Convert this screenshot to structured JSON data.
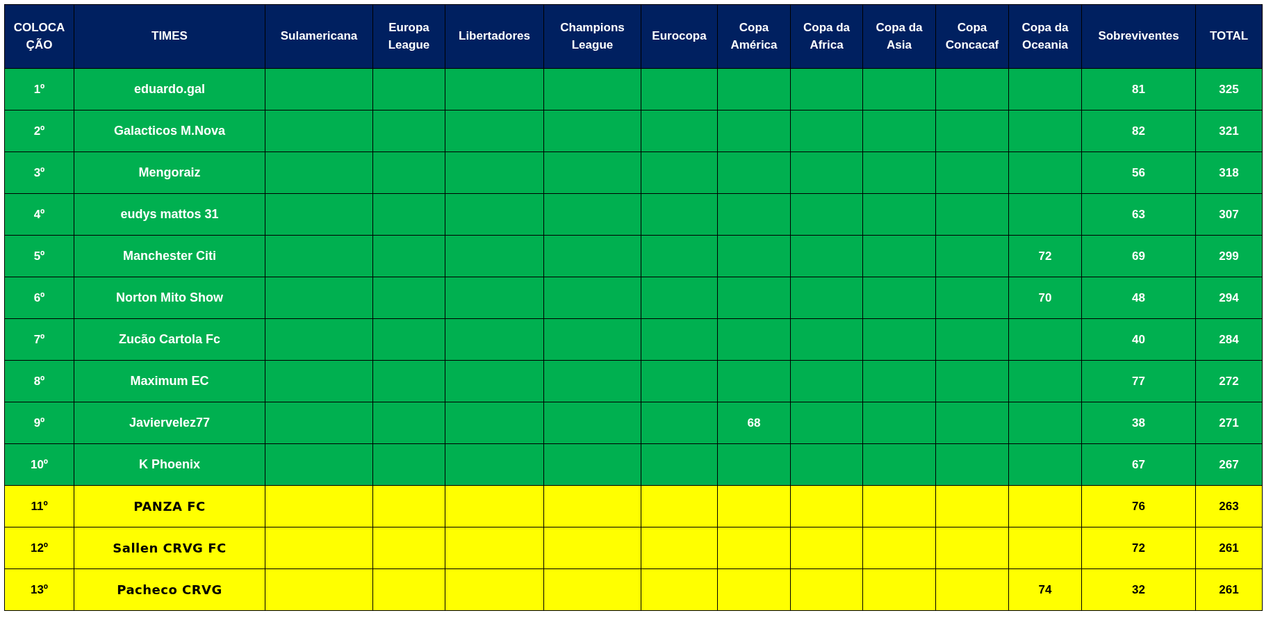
{
  "table": {
    "columns": [
      {
        "label": "COLOCA ÇÃO"
      },
      {
        "label": "TIMES"
      },
      {
        "label": "Sulamericana"
      },
      {
        "label": "Europa League"
      },
      {
        "label": "Libertadores"
      },
      {
        "label": "Champions League"
      },
      {
        "label": "Eurocopa"
      },
      {
        "label": "Copa América"
      },
      {
        "label": "Copa da Africa"
      },
      {
        "label": "Copa da Asia"
      },
      {
        "label": "Copa Concacaf"
      },
      {
        "label": "Copa da Oceania"
      },
      {
        "label": "Sobreviventes"
      },
      {
        "label": "TOTAL"
      }
    ],
    "rows": [
      {
        "color": "#00b050",
        "kind": "plain",
        "cells": [
          "1º",
          "eduardo.gal",
          null,
          null,
          null,
          null,
          null,
          null,
          null,
          null,
          null,
          null,
          "81",
          "325"
        ]
      },
      {
        "color": "#00b050",
        "kind": "plain",
        "cells": [
          "2º",
          "Galacticos M.Nova",
          null,
          null,
          null,
          null,
          null,
          null,
          null,
          null,
          null,
          null,
          "82",
          "321"
        ]
      },
      {
        "color": "#00b050",
        "kind": "plain",
        "cells": [
          "3º",
          "Mengoraiz",
          null,
          null,
          null,
          null,
          null,
          null,
          null,
          null,
          null,
          null,
          "56",
          "318"
        ]
      },
      {
        "color": "#00b050",
        "kind": "plain",
        "cells": [
          "4º",
          "eudys mattos 31",
          null,
          null,
          null,
          null,
          null,
          null,
          null,
          null,
          null,
          null,
          "63",
          "307"
        ]
      },
      {
        "color": "#00b050",
        "kind": "plain",
        "cells": [
          "5º",
          "Manchester Citi",
          null,
          null,
          null,
          null,
          null,
          null,
          null,
          null,
          null,
          "72",
          "69",
          "299"
        ]
      },
      {
        "color": "#00b050",
        "kind": "plain",
        "cells": [
          "6º",
          "Norton Mito Show",
          null,
          null,
          null,
          null,
          null,
          null,
          null,
          null,
          null,
          "70",
          "48",
          "294"
        ]
      },
      {
        "color": "#00b050",
        "kind": "plain",
        "cells": [
          "7º",
          "Zucão Cartola Fc",
          null,
          null,
          null,
          null,
          null,
          null,
          null,
          null,
          null,
          null,
          "40",
          "284"
        ]
      },
      {
        "color": "#00b050",
        "kind": "plain",
        "cells": [
          "8º",
          "Maximum EC",
          null,
          null,
          null,
          null,
          null,
          null,
          null,
          null,
          null,
          null,
          "77",
          "272"
        ]
      },
      {
        "color": "#00b050",
        "kind": "plain",
        "cells": [
          "9º",
          "Javiervelez77",
          null,
          null,
          null,
          null,
          null,
          "68",
          null,
          null,
          null,
          null,
          "38",
          "271"
        ]
      },
      {
        "color": "#00b050",
        "kind": "plain",
        "cells": [
          "10º",
          "K Phoenix",
          null,
          null,
          null,
          null,
          null,
          null,
          null,
          null,
          null,
          null,
          "67",
          "267"
        ]
      },
      {
        "color": "#ffff00",
        "kind": "fancy",
        "cells": [
          "11º",
          "PANZA FC",
          null,
          null,
          null,
          null,
          null,
          null,
          null,
          null,
          null,
          null,
          "76",
          "263"
        ]
      },
      {
        "color": "#ffff00",
        "kind": "fancy",
        "cells": [
          "12º",
          "Sallen CRVG FC",
          null,
          null,
          null,
          null,
          null,
          null,
          null,
          null,
          null,
          null,
          "72",
          "261"
        ]
      },
      {
        "color": "#ffff00",
        "kind": "fancy",
        "cells": [
          "13º",
          "Pacheco CRVG",
          null,
          null,
          null,
          null,
          null,
          null,
          null,
          null,
          null,
          "74",
          "32",
          "261"
        ]
      }
    ]
  }
}
